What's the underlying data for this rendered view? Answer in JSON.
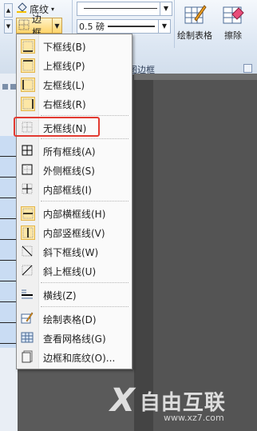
{
  "ribbon": {
    "shading_label": "底纹",
    "borders_label": "边框",
    "pen_weight": "0.5 磅",
    "draw_table_label": "绘制表格",
    "eraser_label": "擦除",
    "group_label": "绘图边框"
  },
  "menu": {
    "items": [
      {
        "label": "下框线(B)",
        "icon": "bottom-border-icon"
      },
      {
        "label": "上框线(P)",
        "icon": "top-border-icon"
      },
      {
        "label": "左框线(L)",
        "icon": "left-border-icon"
      },
      {
        "label": "右框线(R)",
        "icon": "right-border-icon"
      },
      {
        "label": "无框线(N)",
        "icon": "no-border-icon"
      },
      {
        "label": "所有框线(A)",
        "icon": "all-borders-icon"
      },
      {
        "label": "外侧框线(S)",
        "icon": "outside-borders-icon"
      },
      {
        "label": "内部框线(I)",
        "icon": "inside-borders-icon"
      },
      {
        "label": "内部横框线(H)",
        "icon": "inside-horizontal-border-icon"
      },
      {
        "label": "内部竖框线(V)",
        "icon": "inside-vertical-border-icon"
      },
      {
        "label": "斜下框线(W)",
        "icon": "diagonal-down-border-icon"
      },
      {
        "label": "斜上框线(U)",
        "icon": "diagonal-up-border-icon"
      },
      {
        "label": "横线(Z)",
        "icon": "horizontal-line-icon"
      },
      {
        "label": "绘制表格(D)",
        "icon": "draw-table-icon"
      },
      {
        "label": "查看网格线(G)",
        "icon": "view-gridlines-icon"
      },
      {
        "label": "边框和底纹(O)...",
        "icon": "borders-and-shading-icon"
      }
    ]
  },
  "watermark": {
    "brand": "自由互联",
    "url": "www.xz7.com"
  }
}
